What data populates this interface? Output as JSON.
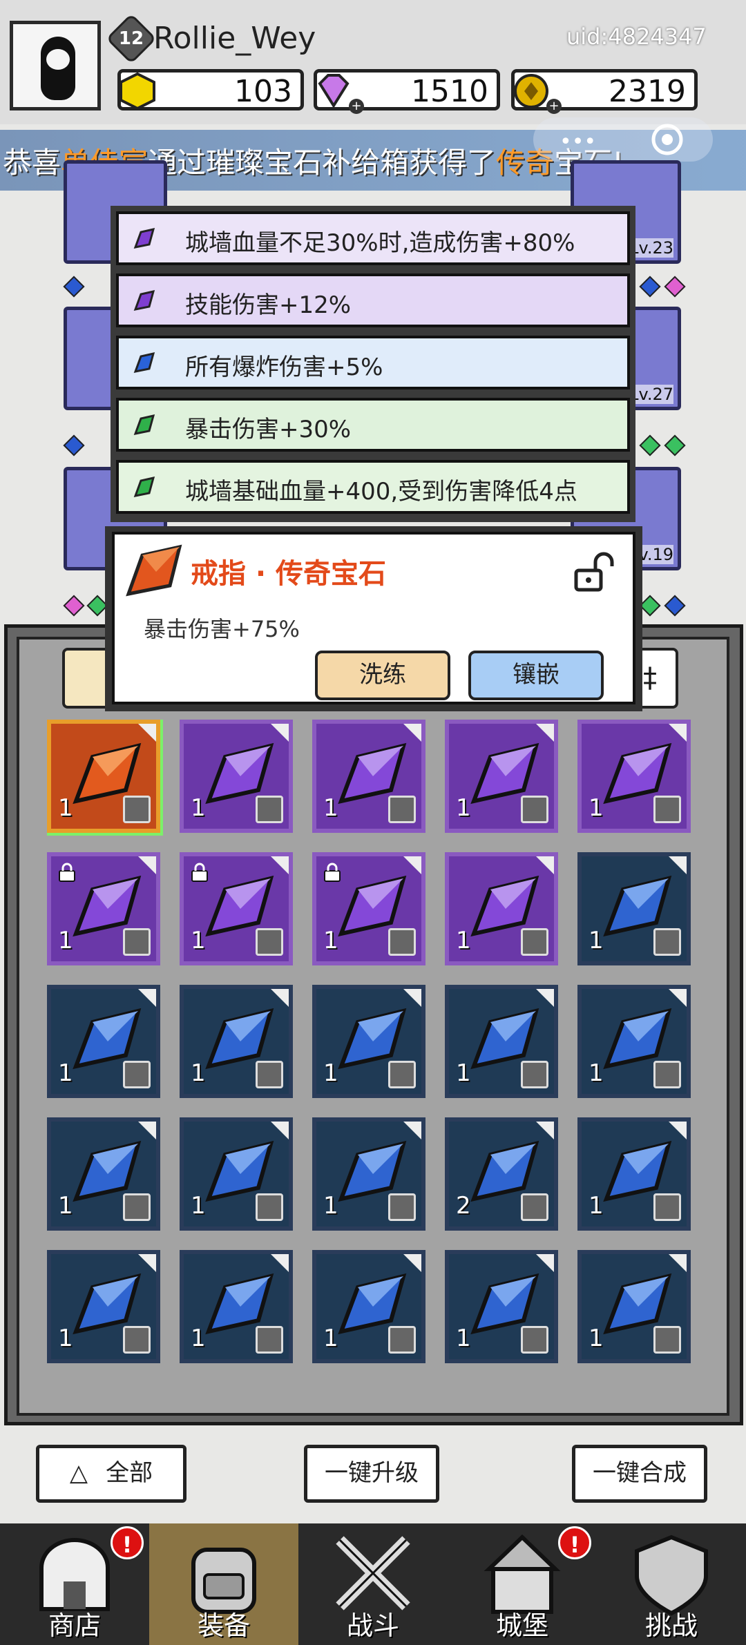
{
  "player": {
    "level": "12",
    "name": "Rollie_Wey",
    "uid": "uid:4824347"
  },
  "resources": [
    {
      "name": "gold-hex",
      "value": "103",
      "color": "#f5d800"
    },
    {
      "name": "diamond",
      "value": "1510",
      "color": "#c070e0"
    },
    {
      "name": "coin",
      "value": "2319",
      "color": "#e0b000"
    }
  ],
  "broadcast": {
    "prefix": "恭喜",
    "player": "单佳宸",
    "middle": "通过璀璨宝石补给箱获得了",
    "item": "传奇",
    "suffix": "宝石!"
  },
  "equipment_levels": [
    "Lv.23",
    "Lv.27",
    "Lv.19"
  ],
  "attributes": [
    {
      "label": "城墙血量不足30%时,造成伤害+80%",
      "gem": "purple",
      "bg": "#ece4f8"
    },
    {
      "label": "技能伤害+12%",
      "gem": "purple",
      "bg": "#e4d8f6"
    },
    {
      "label": "所有爆炸伤害+5%",
      "gem": "blue",
      "bg": "#e0ecfa"
    },
    {
      "label": "暴击伤害+30%",
      "gem": "green",
      "bg": "#dff2dc"
    },
    {
      "label": "城墙基础血量+400,受到伤害降低4点",
      "gem": "green",
      "bg": "#e4f4e0"
    }
  ],
  "gem_popup": {
    "title": "戒指 · 传奇宝石",
    "effect": "暴击伤害+75%",
    "refine_label": "洗练",
    "inlay_label": "镶嵌"
  },
  "inventory": [
    {
      "rarity": "legend",
      "count": "1",
      "locked": false
    },
    {
      "rarity": "purple",
      "count": "1",
      "locked": false
    },
    {
      "rarity": "purple",
      "count": "1",
      "locked": false
    },
    {
      "rarity": "purple",
      "count": "1",
      "locked": false
    },
    {
      "rarity": "purple",
      "count": "1",
      "locked": false
    },
    {
      "rarity": "purple",
      "count": "1",
      "locked": true
    },
    {
      "rarity": "purple",
      "count": "1",
      "locked": true
    },
    {
      "rarity": "purple",
      "count": "1",
      "locked": true
    },
    {
      "rarity": "purple",
      "count": "1",
      "locked": false
    },
    {
      "rarity": "blue",
      "count": "1",
      "locked": false
    },
    {
      "rarity": "blue",
      "count": "1",
      "locked": false
    },
    {
      "rarity": "blue",
      "count": "1",
      "locked": false
    },
    {
      "rarity": "blue",
      "count": "1",
      "locked": false
    },
    {
      "rarity": "blue",
      "count": "1",
      "locked": false
    },
    {
      "rarity": "blue",
      "count": "1",
      "locked": false
    },
    {
      "rarity": "blue",
      "count": "1",
      "locked": false
    },
    {
      "rarity": "blue",
      "count": "1",
      "locked": false
    },
    {
      "rarity": "blue",
      "count": "1",
      "locked": false
    },
    {
      "rarity": "blue",
      "count": "2",
      "locked": false
    },
    {
      "rarity": "blue",
      "count": "1",
      "locked": false
    },
    {
      "rarity": "blue",
      "count": "1",
      "locked": false
    },
    {
      "rarity": "blue",
      "count": "1",
      "locked": false
    },
    {
      "rarity": "blue",
      "count": "1",
      "locked": false
    },
    {
      "rarity": "blue",
      "count": "1",
      "locked": false
    },
    {
      "rarity": "blue",
      "count": "1",
      "locked": false
    }
  ],
  "controls": {
    "filter_label": "全部",
    "upgrade_label": "一键升级",
    "merge_label": "一键合成"
  },
  "nav": [
    {
      "label": "商店",
      "icon": "shop-icon",
      "alert": true,
      "active": false
    },
    {
      "label": "装备",
      "icon": "backpack-icon",
      "alert": false,
      "active": true
    },
    {
      "label": "战斗",
      "icon": "swords-icon",
      "alert": false,
      "active": false
    },
    {
      "label": "城堡",
      "icon": "castle-icon",
      "alert": true,
      "active": false
    },
    {
      "label": "挑战",
      "icon": "shield-icon",
      "alert": false,
      "active": false
    }
  ],
  "alert_mark": "!"
}
